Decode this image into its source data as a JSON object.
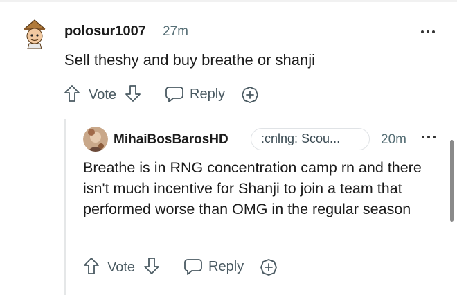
{
  "comments": [
    {
      "username": "polosur1007",
      "time": "27m",
      "text": "Sell theshy and buy breathe or shanji",
      "actions": {
        "vote": "Vote",
        "reply": "Reply"
      }
    },
    {
      "username": "MihaiBosBarosHD",
      "flair": ":cnlng: Scou...",
      "time": "20m",
      "text": "Breathe is in RNG concentration camp rn and there isn't much incentive for Shanji to join a team that performed worse than OMG in the regular season",
      "actions": {
        "vote": "Vote",
        "reply": "Reply"
      }
    }
  ],
  "icons": {
    "upvote": "arrow-up-icon",
    "downvote": "arrow-down-icon",
    "reply": "speech-bubble-icon",
    "award": "plus-circle-icon",
    "more": "more-horizontal-icon"
  },
  "colors": {
    "text": "#1c1c1c",
    "meta": "#576f76",
    "action": "#4a5a62",
    "thread_line": "#e5e7e8"
  }
}
